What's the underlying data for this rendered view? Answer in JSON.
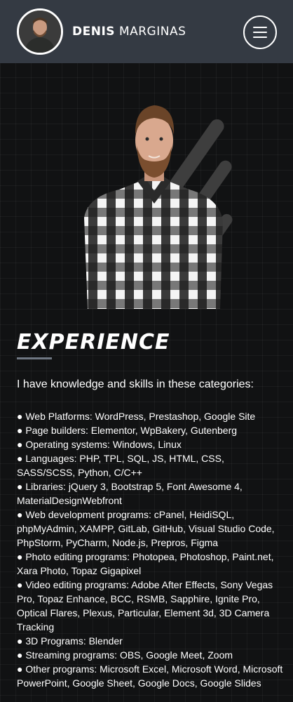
{
  "header": {
    "name_first": "DENIS",
    "name_last": "MARGINAS",
    "avatar_icon": "profile-photo",
    "menu_icon": "hamburger-icon"
  },
  "hero": {
    "image": "portrait-plaid-shirt"
  },
  "experience": {
    "title": "EXPERIENCE",
    "intro": "I have knowledge and skills in these categories:",
    "items": [
      "● Web Platforms: WordPress, Prestashop, Google Site",
      "● Page builders: Elementor, WpBakery, Gutenberg",
      "● Operating systems: Windows, Linux",
      "● Languages: PHP, TPL, SQL, JS, HTML, CSS, SASS/SCSS, Python, C/C++",
      "● Libraries: jQuery 3, Bootstrap 5, Font Awesome 4, MaterialDesignWebfront",
      "● Web development programs: cPanel, HeidiSQL, phpMyAdmin, XAMPP, GitLab, GitHub, Visual Studio Code, PhpStorm, PyCharm, Node.js, Prepros, Figma",
      "● Photo editing programs: Photopea, Photoshop, Paint.net, Xara Photo, Topaz Gigapixel",
      "● Video editing programs: Adobe After Effects, Sony Vegas Pro, Topaz Enhance, BCC, RSMB, Sapphire, Ignite Pro, Optical Flares, Plexus, Particular, Element 3d, 3D Camera Tracking",
      "● 3D Programs: Blender",
      "● Streaming programs: OBS, Google Meet, Zoom",
      "● Other programs: Microsoft Excel, Microsoft Word, Microsoft PowerPoint, Google Sheet, Google Docs, Google Slides"
    ]
  },
  "colors": {
    "header_bg": "#343a43",
    "page_bg": "#111213",
    "accent_underline": "#6f7782"
  }
}
